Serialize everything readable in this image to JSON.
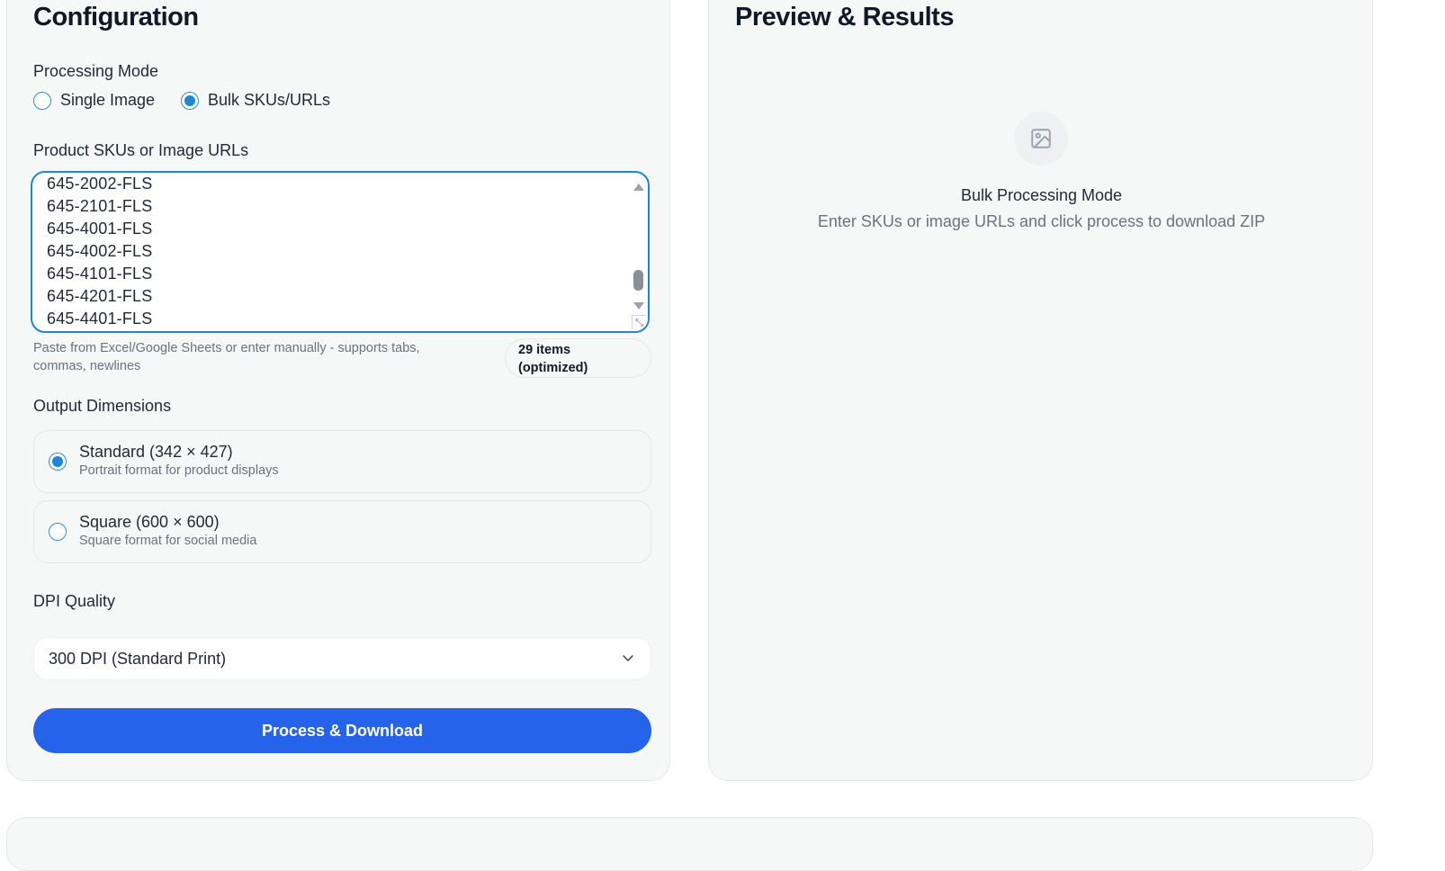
{
  "config": {
    "title": "Configuration",
    "processing_mode": {
      "label": "Processing Mode",
      "options": [
        {
          "label": "Single Image",
          "selected": false
        },
        {
          "label": "Bulk SKUs/URLs",
          "selected": true
        }
      ]
    },
    "skus": {
      "label": "Product SKUs or Image URLs",
      "lines": [
        "645-2002-FLS",
        "645-2101-FLS",
        "645-4001-FLS",
        "645-4002-FLS",
        "645-4101-FLS",
        "645-4201-FLS",
        "645-4401-FLS"
      ],
      "hint": "Paste from Excel/Google Sheets or enter manually - supports tabs, commas, newlines",
      "count_badge": "29 items (optimized)"
    },
    "output_dimensions": {
      "label": "Output Dimensions",
      "options": [
        {
          "title": "Standard (342 × 427)",
          "subtitle": "Portrait format for product displays",
          "selected": true
        },
        {
          "title": "Square (600 × 600)",
          "subtitle": "Square format for social media",
          "selected": false
        }
      ]
    },
    "dpi": {
      "label": "DPI Quality",
      "value": "300 DPI (Standard Print)"
    },
    "process_button": "Process & Download"
  },
  "preview": {
    "title": "Preview & Results",
    "icon": "image-icon",
    "heading": "Bulk Processing Mode",
    "description": "Enter SKUs or image URLs and click process to download ZIP"
  },
  "colors": {
    "accent": "#1d87dc",
    "primary_button": "#2563eb",
    "card_bg": "#f6f7f7"
  }
}
